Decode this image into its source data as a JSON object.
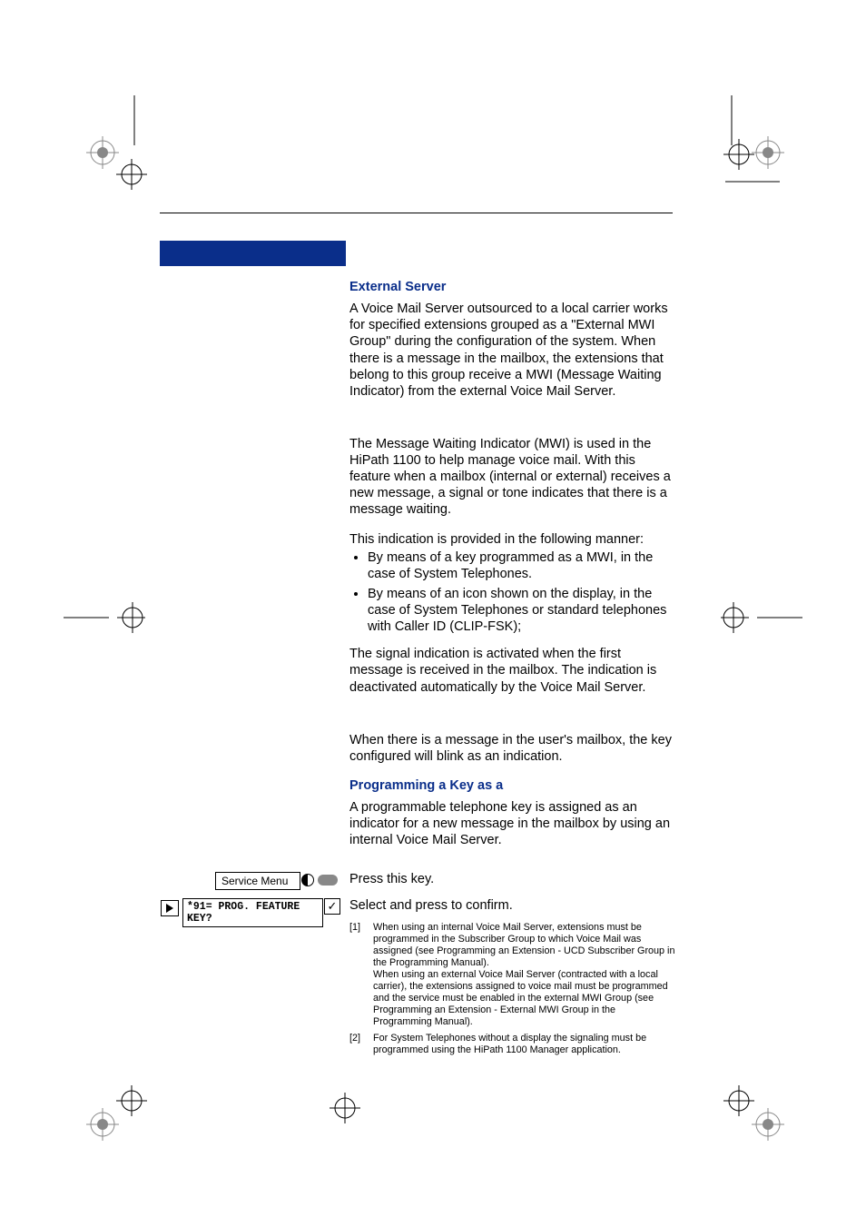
{
  "headings": {
    "external_server": "External Server",
    "programming_key": "Programming a Key as a"
  },
  "paragraphs": {
    "ext_server_body": "A Voice Mail Server outsourced to a local carrier works for specified extensions grouped as a \"External MWI Group\" during the configuration of the system. When there is a message in the mailbox, the extensions that belong to this group receive a MWI (Message Waiting Indicator) from the external Voice Mail Server.",
    "mwi_intro": "The Message Waiting Indicator (MWI) is used in the HiPath 1100 to help manage voice mail. With this feature when a mailbox (internal or external) receives a new message, a signal or tone indicates that there is a message waiting.",
    "indication_lead": "This indication is provided in the following manner:",
    "signal_body": "The signal indication is activated when the first message is received in the mailbox. The indication is deactivated automatically by the Voice Mail Server.",
    "key_blink": "When there is a message in the user's mailbox, the key configured will blink as an indication.",
    "prog_key_body": "A programmable telephone key is assigned as an indicator for a new message in the mailbox by using an internal Voice Mail Server."
  },
  "bullets": {
    "b1": "By means of a key programmed as a MWI, in the case of System Telephones.",
    "b2": "By means of an icon shown on the display, in the case of  System Telephones or standard telephones with Caller ID (CLIP-FSK);"
  },
  "ui": {
    "service_menu": "Service Menu",
    "prog_feature": "*91= PROG. FEATURE KEY?",
    "press_key": "Press this key.",
    "select_confirm": "Select and press to confirm.",
    "check": "✓"
  },
  "footnotes": {
    "n1": "[1]",
    "t1a": "When using an internal Voice Mail Server, extensions must be programmed in the Subscriber Group to which Voice Mail was assigned (see Programming an Extension - UCD Subscriber Group in the Programming Manual).",
    "t1b": "When using an external Voice Mail Server (contracted with a local carrier), the extensions assigned to voice mail must be programmed and the service must be enabled in the external MWI Group (see Programming an Extension - External MWI Group in the Programming Manual).",
    "n2": "[2]",
    "t2": "For System Telephones without a display the signaling must be programmed using the HiPath 1100 Manager application."
  }
}
